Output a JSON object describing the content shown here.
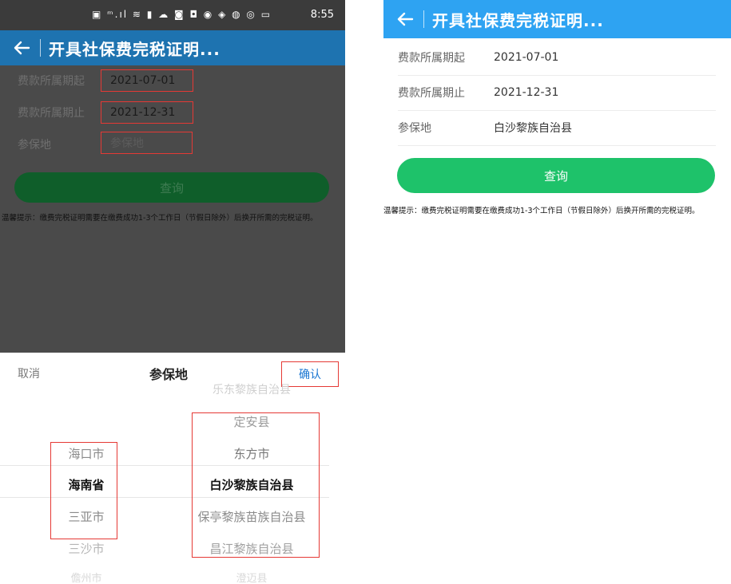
{
  "status_bar": {
    "icons": "▣ ᵐ.ıl ≋ ▮ ☁ ◙ ◘ ◉    ◈ ◍ ◎ ▭",
    "time": "8:55"
  },
  "app_bar": {
    "title": "开具社保费完税证明..."
  },
  "form": {
    "start_label": "费款所属期起",
    "start_value": "2021-07-01",
    "end_label": "费款所属期止",
    "end_value": "2021-12-31",
    "place_label": "参保地",
    "place_placeholder": "参保地",
    "place_value": "白沙黎族自治县"
  },
  "query_button": "查询",
  "tip": "温馨提示：缴费完税证明需要在缴费成功1-3个工作日（节假日除外）后换开所需的完税证明。",
  "picker": {
    "cancel": "取消",
    "title": "参保地",
    "confirm": "确认",
    "col1": [
      "海口市",
      "海南省",
      "三亚市",
      "三沙市",
      "儋州市"
    ],
    "col2": [
      "乐东黎族自治县",
      "定安县",
      "东方市",
      "白沙黎族自治县",
      "保亭黎族苗族自治县",
      "昌江黎族自治县",
      "澄迈县"
    ]
  },
  "colors": {
    "appbar": "#2ea3f2",
    "button": "#1ec26a",
    "highlight_box": "#e53935",
    "confirm": "#1976d2"
  }
}
